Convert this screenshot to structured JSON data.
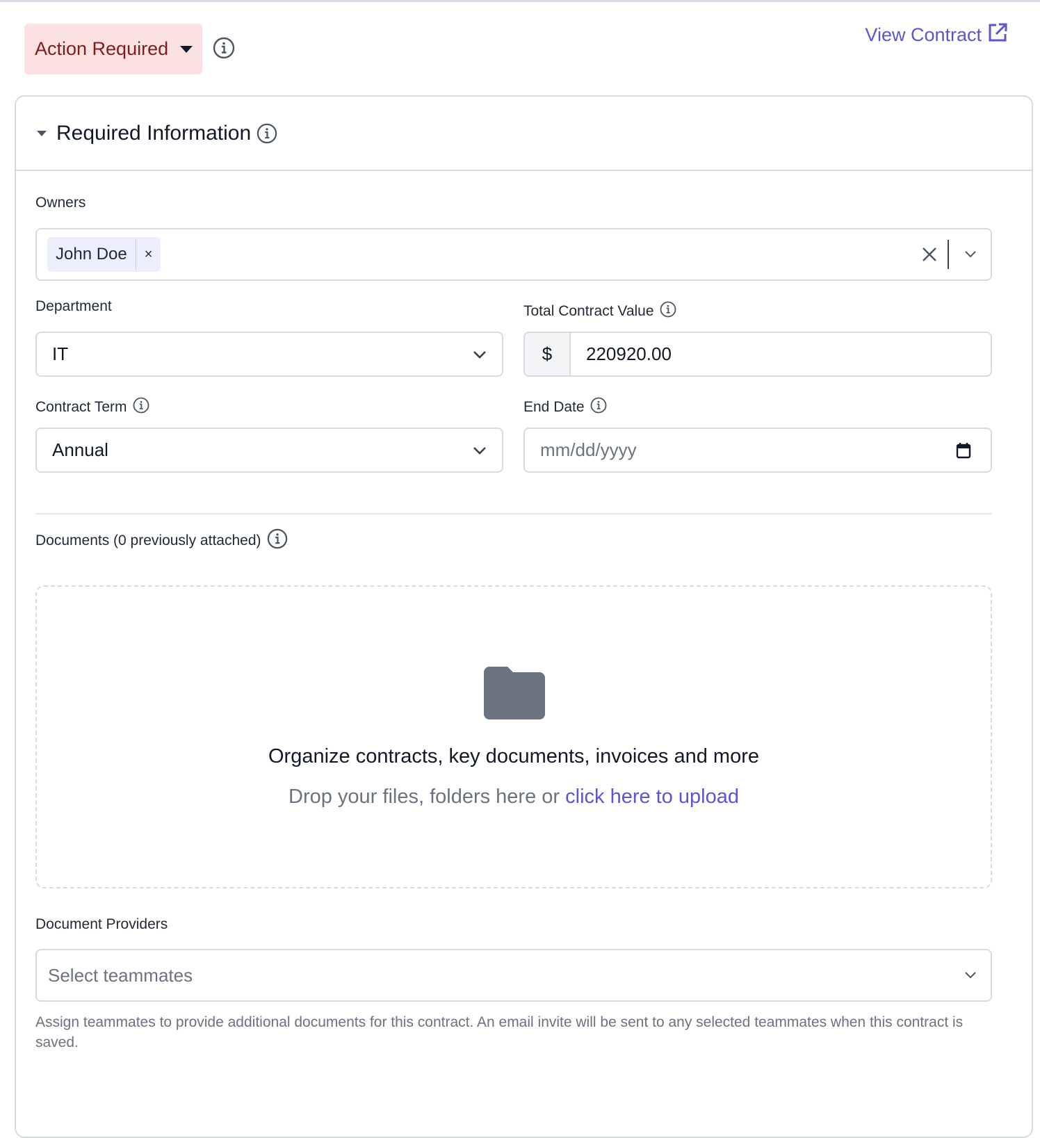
{
  "header": {
    "status_label": "Action Required",
    "view_contract_label": "View Contract"
  },
  "section": {
    "title": "Required Information"
  },
  "owners": {
    "label": "Owners",
    "chips": [
      "John Doe"
    ],
    "chip_remove": "×"
  },
  "department": {
    "label": "Department",
    "value": "IT"
  },
  "total_contract_value": {
    "label": "Total Contract Value",
    "prefix": "$",
    "value": "220920.00"
  },
  "contract_term": {
    "label": "Contract Term",
    "value": "Annual"
  },
  "end_date": {
    "label": "End Date",
    "placeholder": "mm/dd/yyyy"
  },
  "documents": {
    "label": "Documents (0 previously attached)",
    "dropzone_title": "Organize contracts, key documents, invoices and more",
    "dropzone_text": "Drop your files, folders here or ",
    "dropzone_link": "click here to upload"
  },
  "document_providers": {
    "label": "Document Providers",
    "placeholder": "Select teammates",
    "helper": "Assign teammates to provide additional documents for this contract. An email invite will be sent to any selected teammates when this contract is saved."
  },
  "colors": {
    "accent": "#5b55d6",
    "status_bg": "#fbe1e2",
    "status_text": "#7f1d1d",
    "border": "#d6dbe3",
    "muted": "#6b7280"
  }
}
